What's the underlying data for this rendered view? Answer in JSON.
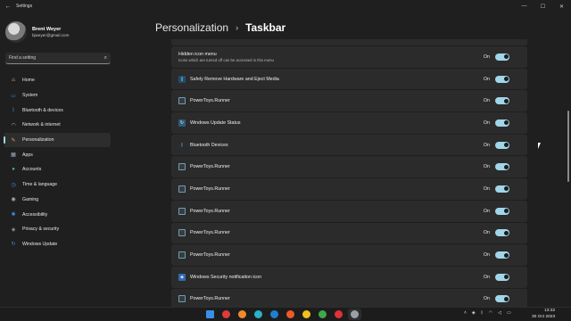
{
  "window": {
    "app_title": "Settings",
    "back_icon": "arrow-left-icon",
    "controls": [
      "minimize",
      "maximize",
      "close"
    ]
  },
  "profile": {
    "name": "Brent Weyer",
    "email": "bjweyer@gmail.com"
  },
  "search": {
    "placeholder": "Find a setting"
  },
  "nav": {
    "items": [
      {
        "label": "Home",
        "icon": "home-icon",
        "color": "#e8e8e8"
      },
      {
        "label": "System",
        "icon": "monitor-icon",
        "color": "#3a8ee6"
      },
      {
        "label": "Bluetooth & devices",
        "icon": "bluetooth-icon",
        "color": "#3a8ee6"
      },
      {
        "label": "Network & internet",
        "icon": "wifi-icon",
        "color": "#9fd6e8"
      },
      {
        "label": "Personalization",
        "icon": "brush-icon",
        "color": "#e0a070",
        "active": true
      },
      {
        "label": "Apps",
        "icon": "apps-icon",
        "color": "#9fb0c8"
      },
      {
        "label": "Accounts",
        "icon": "person-icon",
        "color": "#3fbf7f"
      },
      {
        "label": "Time & language",
        "icon": "globe-clock-icon",
        "color": "#3a8ee6"
      },
      {
        "label": "Gaming",
        "icon": "controller-icon",
        "color": "#b0b0b0"
      },
      {
        "label": "Accessibility",
        "icon": "accessibility-icon",
        "color": "#3a8ee6"
      },
      {
        "label": "Privacy & security",
        "icon": "shield-icon",
        "color": "#9aa0a8"
      },
      {
        "label": "Windows Update",
        "icon": "refresh-icon",
        "color": "#3a8ee6"
      }
    ]
  },
  "header": {
    "parent": "Personalization",
    "separator": "›",
    "current": "Taskbar"
  },
  "hidden_menu": {
    "title": "Hidden icon menu",
    "subtitle": "Icons which are turned off can be accessed in this menu",
    "state": "On"
  },
  "rows": [
    {
      "label": "Safely Remove Hardware and Eject Media",
      "icon": "usb-drive-icon",
      "state": "On"
    },
    {
      "label": "PowerToys.Runner",
      "icon": "powertoys-icon",
      "state": "On"
    },
    {
      "label": "Windows Update Status",
      "icon": "windows-update-icon",
      "state": "On"
    },
    {
      "label": "Bluetooth Devices",
      "icon": "bluetooth-icon",
      "state": "On"
    },
    {
      "label": "PowerToys.Runner",
      "icon": "powertoys-icon",
      "state": "On"
    },
    {
      "label": "PowerToys.Runner",
      "icon": "powertoys-icon",
      "state": "On"
    },
    {
      "label": "PowerToys.Runner",
      "icon": "powertoys-icon",
      "state": "On"
    },
    {
      "label": "PowerToys.Runner",
      "icon": "powertoys-icon",
      "state": "On"
    },
    {
      "label": "PowerToys.Runner",
      "icon": "powertoys-icon",
      "state": "On"
    },
    {
      "label": "Windows Security notification icon",
      "icon": "windows-security-icon",
      "state": "On"
    },
    {
      "label": "PowerToys.Runner",
      "icon": "powertoys-icon",
      "state": "On"
    }
  ],
  "colors": {
    "accent": "#9fd6e8",
    "background": "#1f1f1f",
    "card": "#2b2b2b"
  },
  "taskbar": {
    "apps": [
      {
        "icon": "windows-start-icon",
        "color": "#3a8ee6"
      },
      {
        "icon": "vivaldi-icon",
        "color": "#e03a3a"
      },
      {
        "icon": "firefox-icon",
        "color": "#f08a2a"
      },
      {
        "icon": "edge-icon",
        "color": "#2ab0c8"
      },
      {
        "icon": "edge-beta-icon",
        "color": "#1f7fd0"
      },
      {
        "icon": "brave-icon",
        "color": "#f05a28"
      },
      {
        "icon": "chrome-canary-icon",
        "color": "#f0c020"
      },
      {
        "icon": "chrome-icon",
        "color": "#3fa84a"
      },
      {
        "icon": "opera-icon",
        "color": "#e0303a"
      },
      {
        "icon": "settings-icon",
        "color": "#9aa0a8",
        "active": true
      }
    ],
    "time": "13:32",
    "date": "30 Oct 2023"
  }
}
